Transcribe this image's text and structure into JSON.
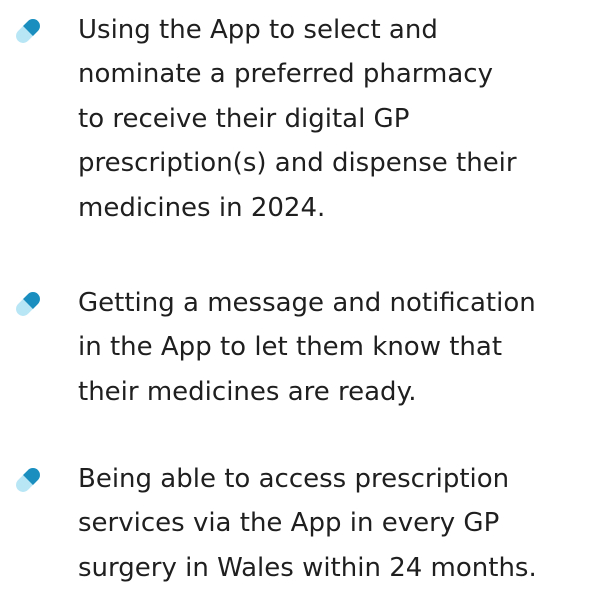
{
  "items": [
    {
      "icon": "pill-capsule-icon",
      "text": "Using the App to select and\nnominate a preferred pharmacy\nto receive their digital GP\nprescription(s) and dispense their\nmedicines in 2024."
    },
    {
      "icon": "pill-capsule-icon",
      "text": "Getting a message and notification\nin the App to let them know that\ntheir medicines are ready."
    },
    {
      "icon": "pill-capsule-icon",
      "text": "Being able to access prescription\nservices via the App in every GP\nsurgery in Wales within 24 months."
    }
  ],
  "colors": {
    "text": "#1f1f1f",
    "capsule_light": "#b9e6f5",
    "capsule_dark": "#1a8fbf"
  }
}
